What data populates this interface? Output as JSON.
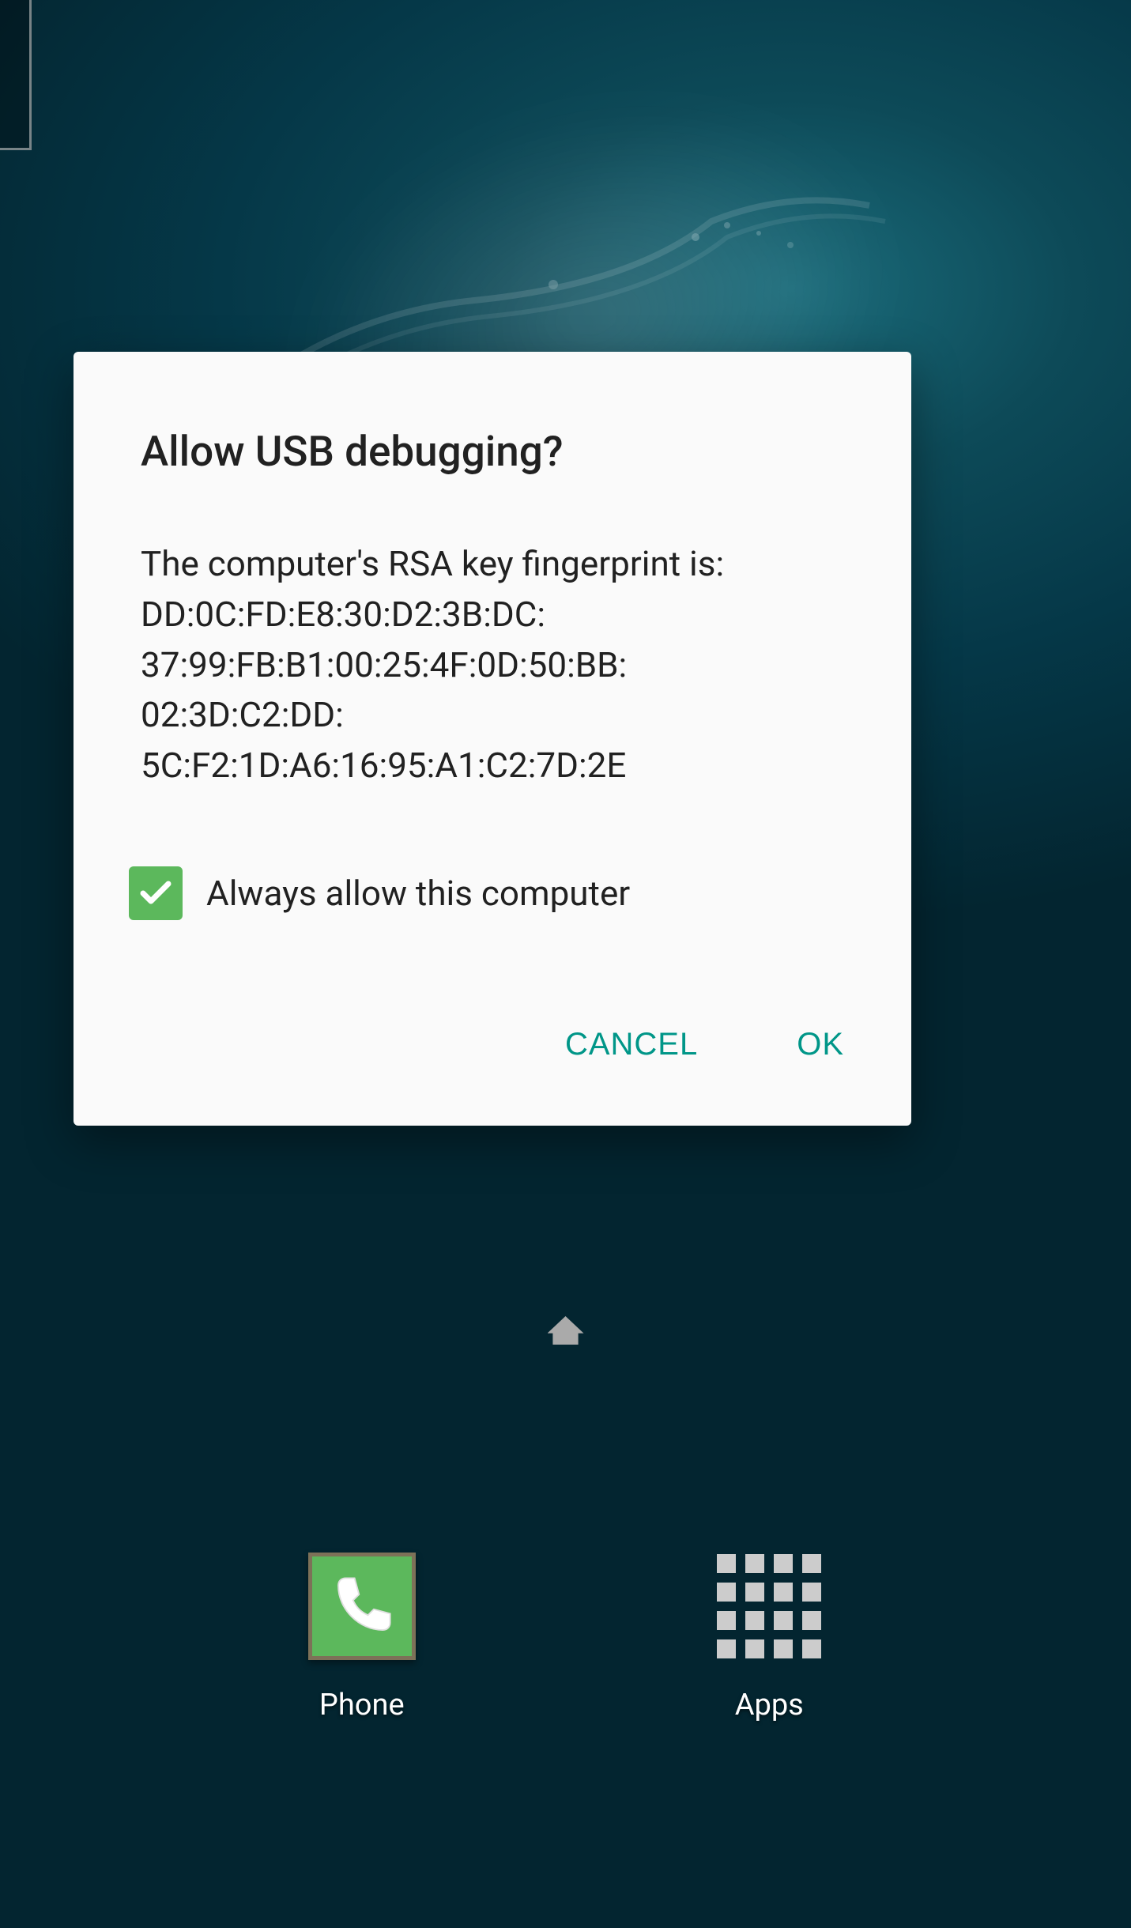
{
  "dialog": {
    "title": "Allow USB debugging?",
    "body_intro": "The computer's RSA key fingerprint is:",
    "fingerprint": "DD:0C:FD:E8:30:D2:3B:DC:\n37:99:FB:B1:00:25:4F:0D:50:BB:\n02:3D:C2:DD:\n5C:F2:1D:A6:16:95:A1:C2:7D:2E",
    "checkbox_label": "Always allow this computer",
    "checkbox_checked": true,
    "cancel_label": "CANCEL",
    "ok_label": "OK"
  },
  "dock": {
    "phone_label": "Phone",
    "apps_label": "Apps"
  },
  "colors": {
    "accent": "#009688",
    "checkbox_green": "#5cb85c",
    "dialog_bg": "#fafafa",
    "text_primary": "#212121"
  }
}
